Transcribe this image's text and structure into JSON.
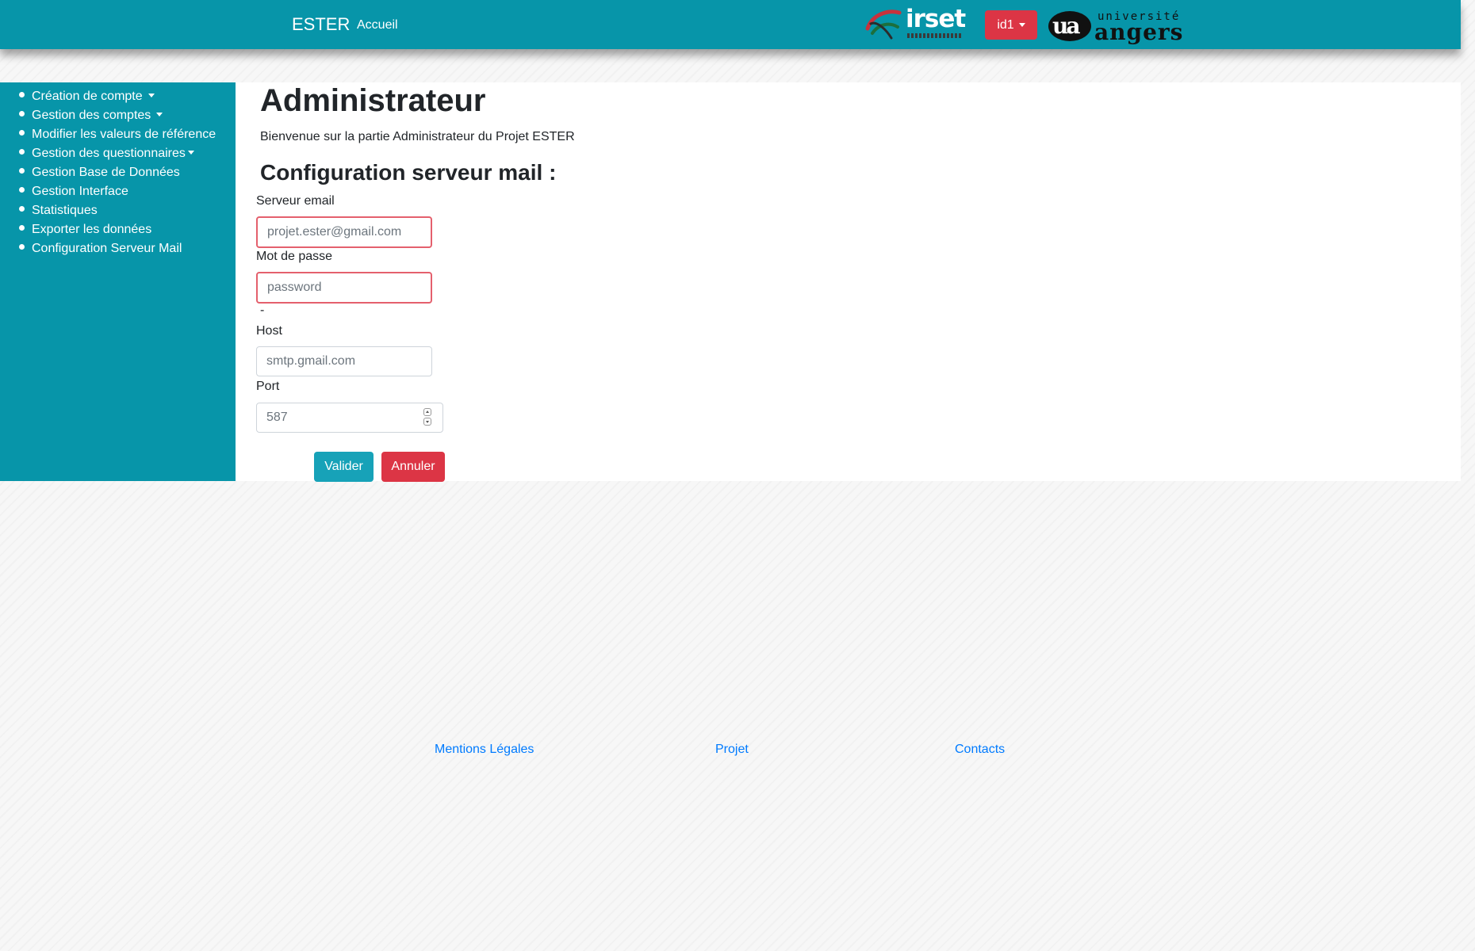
{
  "navbar": {
    "brand": "ESTER",
    "home_link": "Accueil",
    "irset_logo_text": "irset",
    "user_menu": "id1",
    "ua_logo": {
      "mark": "ua",
      "line1": "université",
      "line2": "angers"
    },
    "color": "#0795a9"
  },
  "sidebar": {
    "items": [
      {
        "label": "Création de compte",
        "dropdown": true
      },
      {
        "label": "Gestion des comptes",
        "dropdown": true
      },
      {
        "label": "Modifier les valeurs de référence",
        "dropdown": false
      },
      {
        "label": "Gestion des questionnaires",
        "dropdown": true
      },
      {
        "label": "Gestion Base de Données",
        "dropdown": false
      },
      {
        "label": "Gestion Interface",
        "dropdown": false
      },
      {
        "label": "Statistiques",
        "dropdown": false
      },
      {
        "label": "Exporter les données",
        "dropdown": false
      },
      {
        "label": "Configuration Serveur Mail",
        "dropdown": false
      }
    ]
  },
  "main": {
    "title": "Administrateur",
    "welcome": "Bienvenue sur la partie Administrateur du Projet ESTER",
    "section_title": "Configuration serveur mail :",
    "form": {
      "email_label": "Serveur email",
      "email_placeholder": "projet.ester@gmail.com",
      "password_label": "Mot de passe",
      "password_placeholder": "password",
      "separator": "-",
      "host_label": "Host",
      "host_placeholder": "smtp.gmail.com",
      "port_label": "Port",
      "port_value": "587",
      "submit_label": "Valider",
      "cancel_label": "Annuler"
    }
  },
  "footer": {
    "links": [
      "Mentions Légales",
      "Projet",
      "Contacts"
    ]
  }
}
